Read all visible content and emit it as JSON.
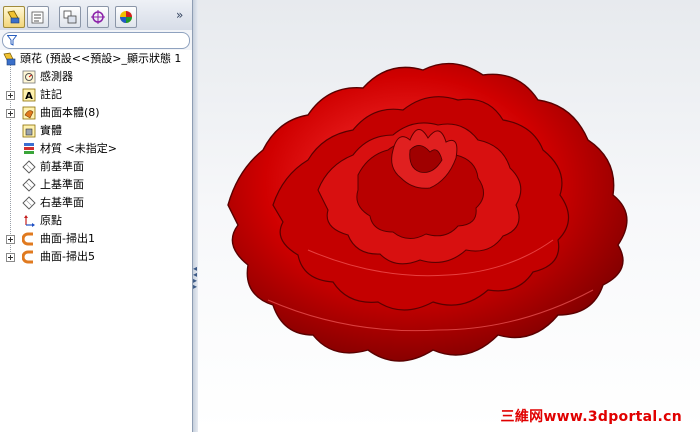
{
  "panel": {
    "tabs": [
      "feature-manager-icon",
      "property-manager-icon",
      "configuration-manager-icon",
      "dimxpert-icon",
      "display-manager-icon"
    ],
    "more_glyph": "»"
  },
  "tree": {
    "root": "頭花 (預設<<預設>_顯示狀態 1",
    "items": [
      {
        "label": "感測器",
        "icon": "sensor-icon",
        "expandable": false
      },
      {
        "label": "註記",
        "icon": "annotation-icon",
        "expandable": true
      },
      {
        "label": "曲面本體(8)",
        "icon": "surface-bodies-icon",
        "expandable": true
      },
      {
        "label": "實體",
        "icon": "solid-bodies-icon",
        "expandable": false
      },
      {
        "label": "材質 <未指定>",
        "icon": "material-icon",
        "expandable": false
      },
      {
        "label": "前基準面",
        "icon": "plane-icon",
        "expandable": false
      },
      {
        "label": "上基準面",
        "icon": "plane-icon",
        "expandable": false
      },
      {
        "label": "右基準面",
        "icon": "plane-icon",
        "expandable": false
      },
      {
        "label": "原點",
        "icon": "origin-icon",
        "expandable": false
      },
      {
        "label": "曲面-掃出1",
        "icon": "sweep-surface-icon",
        "expandable": true
      },
      {
        "label": "曲面-掃出5",
        "icon": "sweep-surface-icon",
        "expandable": true
      }
    ]
  },
  "viewport": {
    "model_color": "#cc0000",
    "watermark": "三維网www.3dportal.cn"
  }
}
